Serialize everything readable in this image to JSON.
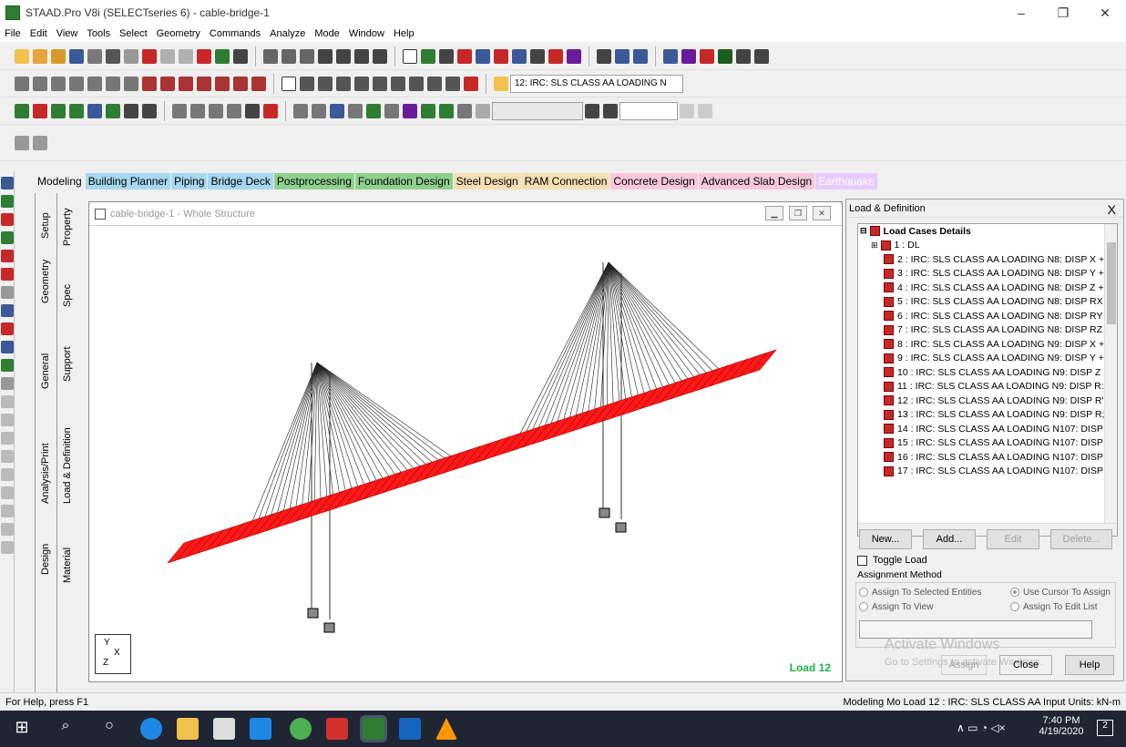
{
  "window": {
    "title": "STAAD.Pro V8i (SELECTseries 6) - cable-bridge-1",
    "minimize": "–",
    "restore": "❐",
    "close": "✕"
  },
  "menu": [
    "File",
    "Edit",
    "View",
    "Tools",
    "Select",
    "Geometry",
    "Commands",
    "Analyze",
    "Mode",
    "Window",
    "Help"
  ],
  "toolbar": {
    "load_case_select": "12: IRC: SLS CLASS AA LOADING N"
  },
  "workflow_tabs": [
    {
      "label": "Modeling",
      "bg": "#f0f0f0"
    },
    {
      "label": "Building Planner",
      "bg": "#a6d8f0"
    },
    {
      "label": "Piping",
      "bg": "#a6d8f0"
    },
    {
      "label": "Bridge Deck",
      "bg": "#a6d8f0"
    },
    {
      "label": "Postprocessing",
      "bg": "#8ed18e"
    },
    {
      "label": "Foundation Design",
      "bg": "#8ed18e"
    },
    {
      "label": "Steel Design",
      "bg": "#f5deb3"
    },
    {
      "label": "RAM Connection",
      "bg": "#f5deb3"
    },
    {
      "label": "Concrete Design",
      "bg": "#f8c8dc"
    },
    {
      "label": "Advanced Slab Design",
      "bg": "#f8c8dc"
    },
    {
      "label": "Earthquake",
      "bg": "#e6ccff"
    }
  ],
  "vertical_tabs": {
    "setup": "Setup",
    "geometry": "Geometry",
    "general": "General",
    "analysis_print": "Analysis/Print",
    "design": "Design",
    "property": "Property",
    "spec": "Spec",
    "support": "Support",
    "load_definition": "Load & Definition",
    "material": "Material"
  },
  "viewport": {
    "title": "cable-bridge-1 - Whole Structure",
    "load_label": "Load 12",
    "axis_y": "Y",
    "axis_x": "X",
    "axis_z": "Z"
  },
  "panel": {
    "title": "Load & Definition",
    "close": "X",
    "tree_root": "Load Cases Details",
    "items": [
      "1 : DL",
      "2 : IRC: SLS CLASS AA LOADING N8: DISP X +",
      "3 : IRC: SLS CLASS AA LOADING N8: DISP Y +",
      "4 : IRC: SLS CLASS AA LOADING N8: DISP Z +",
      "5 : IRC: SLS CLASS AA LOADING N8: DISP RX",
      "6 : IRC: SLS CLASS AA LOADING N8: DISP RY",
      "7 : IRC: SLS CLASS AA LOADING N8: DISP RZ",
      "8 : IRC: SLS CLASS AA LOADING N9: DISP X +",
      "9 : IRC: SLS CLASS AA LOADING N9: DISP Y +",
      "10 : IRC: SLS CLASS AA LOADING N9: DISP Z",
      "11 : IRC: SLS CLASS AA LOADING N9: DISP R:",
      "12 : IRC: SLS CLASS AA LOADING N9: DISP R'",
      "13 : IRC: SLS CLASS AA LOADING N9: DISP R;",
      "14 : IRC: SLS CLASS AA LOADING N107: DISP",
      "15 : IRC: SLS CLASS AA LOADING N107: DISP",
      "16 : IRC: SLS CLASS AA LOADING N107: DISP",
      "17 : IRC: SLS CLASS AA LOADING N107: DISP"
    ],
    "btn_new": "New...",
    "btn_add": "Add...",
    "btn_edit": "Edit",
    "btn_delete": "Delete...",
    "toggle_load": "Toggle Load",
    "assignment_method": "Assignment Method",
    "opt_selected": "Assign To Selected Entities",
    "opt_cursor": "Use Cursor To Assign",
    "opt_view": "Assign To View",
    "opt_editlist": "Assign To Edit List",
    "btn_assign": "Assign",
    "btn_close": "Close",
    "btn_help": "Help",
    "watermark1": "Activate Windows",
    "watermark2": "Go to Settings to activate Windows."
  },
  "status": {
    "left": "For Help, press F1",
    "right": "Modeling Mo  Load 12 : IRC: SLS CLASS AA  Input Units:  kN-m"
  },
  "taskbar": {
    "time": "7:40 PM",
    "date": "4/19/2020",
    "notif_count": "2"
  }
}
